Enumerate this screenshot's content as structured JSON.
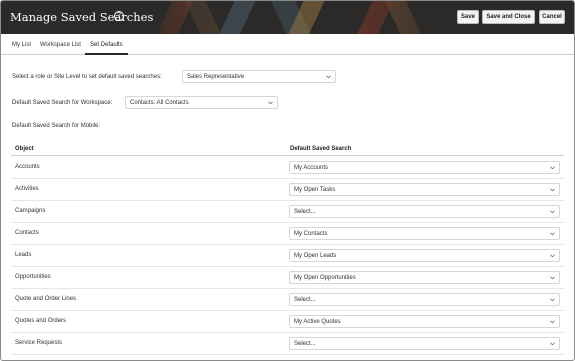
{
  "header": {
    "title": "Manage Saved Searches",
    "help_icon": "question-circle-icon",
    "buttons": {
      "save": "Save",
      "save_close": "Save and Close",
      "cancel": "Cancel"
    }
  },
  "tabs": [
    {
      "label": "My List",
      "active": false
    },
    {
      "label": "Workspace List",
      "active": false
    },
    {
      "label": "Set Defaults",
      "active": true
    }
  ],
  "role": {
    "label": "Select a role or Site Level to set default saved searches:",
    "value": "Sales Representative"
  },
  "workspace": {
    "label": "Default Saved Search for Workspace:",
    "value": "Contacts: All Contacts"
  },
  "mobile": {
    "label": "Default Saved Search for Mobile:"
  },
  "table": {
    "headers": {
      "object": "Object",
      "default": "Default Saved Search"
    },
    "rows": [
      {
        "object": "Accounts",
        "value": "My Accounts"
      },
      {
        "object": "Activities",
        "value": "My Open Tasks"
      },
      {
        "object": "Campaigns",
        "value": "Select..."
      },
      {
        "object": "Contacts",
        "value": "My Contacts"
      },
      {
        "object": "Leads",
        "value": "My Open Leads"
      },
      {
        "object": "Opportunities",
        "value": "My Open Opportunities"
      },
      {
        "object": "Quote and Order Lines",
        "value": "Select..."
      },
      {
        "object": "Quotes and Orders",
        "value": "My Active Quotes"
      },
      {
        "object": "Service Requests",
        "value": "Select..."
      }
    ]
  },
  "icons": {
    "dropdown": "chevron-down-icon"
  },
  "colors": {
    "header_bg": "#2b2a28",
    "accent": "#2b2a28"
  }
}
